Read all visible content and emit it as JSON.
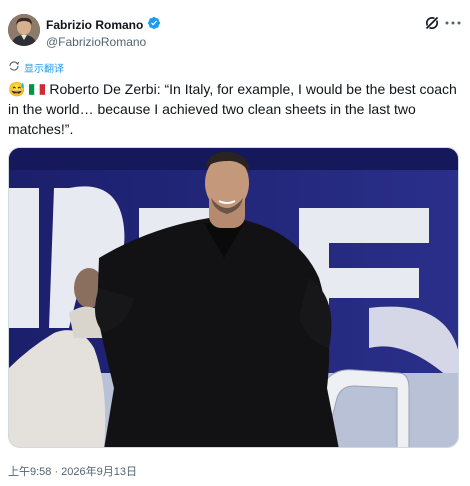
{
  "author": {
    "name": "Fabrizio Romano",
    "handle": "@FabrizioRomano",
    "verified": true,
    "verified_color": "#1d9bf0"
  },
  "translate_label": "显示翻译",
  "post": {
    "emoji": "😅",
    "flag": "italy",
    "text": "Roberto De Zerbi: “In Italy, for example, I would be the best coach in the world… because I achieved two clean sheets in the last two matches!”."
  },
  "timestamp": "上午9:58 · 2026年9月13日",
  "colors": {
    "link": "#1d9bf0",
    "muted": "#536471",
    "text": "#0f1419"
  },
  "icons": {
    "grok": "grok-icon",
    "more": "more-icon",
    "verified": "verified-badge-icon",
    "translate": "translate-icon"
  }
}
